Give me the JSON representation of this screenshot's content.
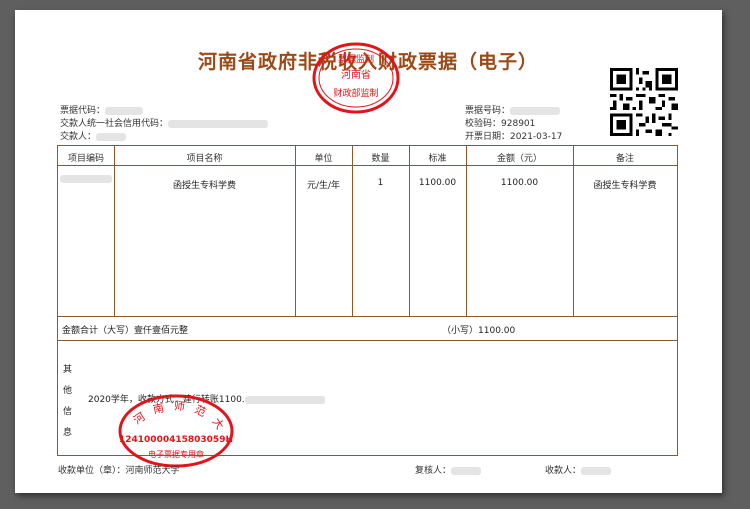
{
  "title": "河南省政府非税收入财政票据（电子）",
  "header": {
    "bill_code_label": "票据代码：",
    "payer_credit_label": "交款人统一社会信用代码：",
    "payer_label": "交款人：",
    "bill_no_label": "票据号码：",
    "check_code_label": "校验码：",
    "check_code_value": "928901",
    "date_label": "开票日期：",
    "date_value": "2021-03-17"
  },
  "table": {
    "columns": [
      "项目编码",
      "项目名称",
      "单位",
      "数量",
      "标准",
      "金额（元）",
      "备注"
    ],
    "rows": [
      {
        "code": "",
        "name": "函授生专科学费",
        "unit": "元/生/年",
        "qty": "1",
        "std": "1100.00",
        "amount": "1100.00",
        "note": "函授生专科学费"
      }
    ],
    "total_label": "金额合计（大写）",
    "total_words": "壹仟壹佰元整",
    "total_small_label": "（小写）",
    "total_small_value": "1100.00",
    "other_info_label": [
      "其",
      "他",
      "信",
      "息"
    ],
    "other_info_text": "2020学年，收款方式：建行转账1100."
  },
  "footer": {
    "payee_unit_label": "收款单位（章）：",
    "payee_unit_value": "河南师范大学",
    "reviewer_label": "复核人：",
    "collector_label": "收款人："
  },
  "stamps": {
    "top": {
      "line1": "票据监制",
      "line2": "河南省",
      "line3": "财政部监制"
    },
    "bottom": {
      "arc": "河南师范大学",
      "code": "12410000415803059H",
      "line": "电子票据专用章"
    }
  },
  "colors": {
    "title": "#9a4a17",
    "border": "#8b5a2b",
    "stamp": "#e0141a"
  }
}
